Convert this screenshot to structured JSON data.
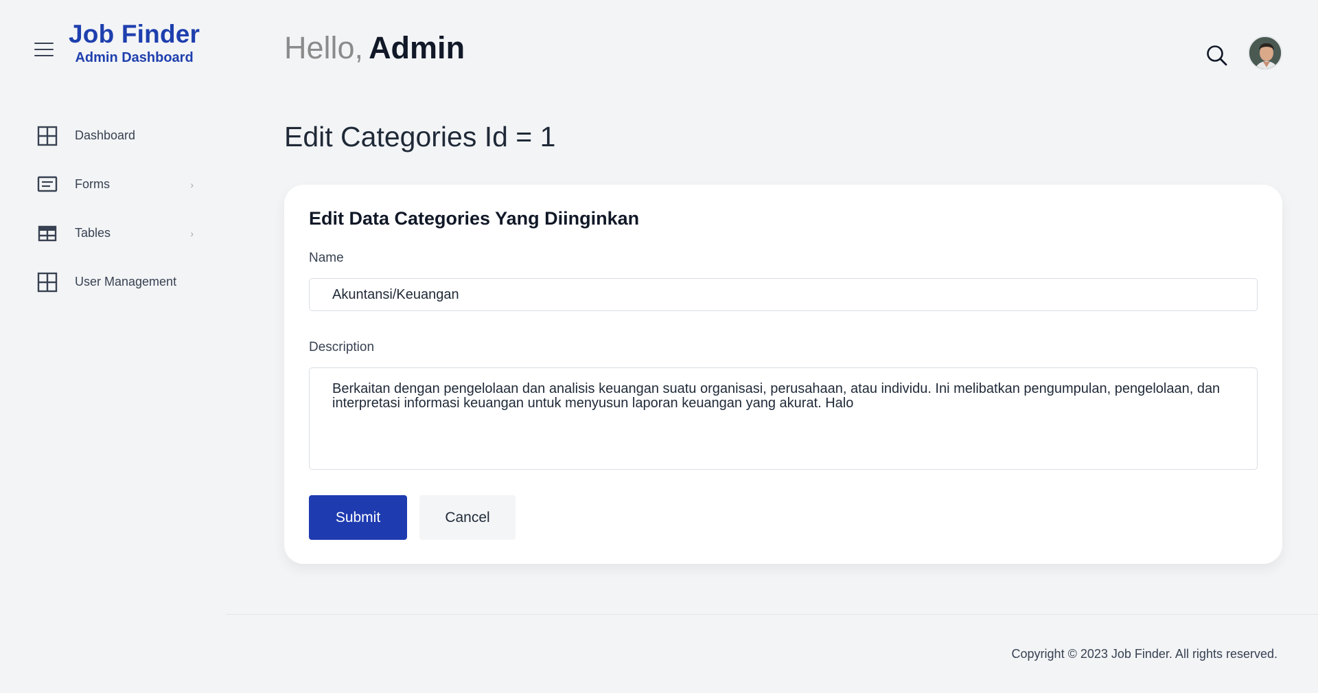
{
  "brand": {
    "title": "Job Finder",
    "subtitle": "Admin Dashboard"
  },
  "sidebar": {
    "items": [
      {
        "label": "Dashboard",
        "icon": "grid-icon",
        "has_submenu": false
      },
      {
        "label": "Forms",
        "icon": "form-icon",
        "has_submenu": true
      },
      {
        "label": "Tables",
        "icon": "table-icon",
        "has_submenu": true
      },
      {
        "label": "User Management",
        "icon": "grid-icon",
        "has_submenu": false
      }
    ],
    "chevron": "›"
  },
  "header": {
    "hello": "Hello,",
    "user": "Admin"
  },
  "page": {
    "title": "Edit Categories Id = 1"
  },
  "form": {
    "card_title": "Edit Data Categories Yang Diinginkan",
    "name_label": "Name",
    "name_value": "Akuntansi/Keuangan",
    "description_label": "Description",
    "description_value": "Berkaitan dengan pengelolaan dan analisis keuangan suatu organisasi, perusahaan, atau individu. Ini melibatkan pengumpulan, pengelolaan, dan interpretasi informasi keuangan untuk menyusun laporan keuangan yang akurat. Halo",
    "submit_label": "Submit",
    "cancel_label": "Cancel"
  },
  "footer": {
    "copyright": "Copyright © 2023 Job Finder. All rights reserved."
  },
  "colors": {
    "brand": "#1e3fae",
    "submit_bg": "#1e3bb0",
    "page_bg": "#f3f4f6"
  }
}
